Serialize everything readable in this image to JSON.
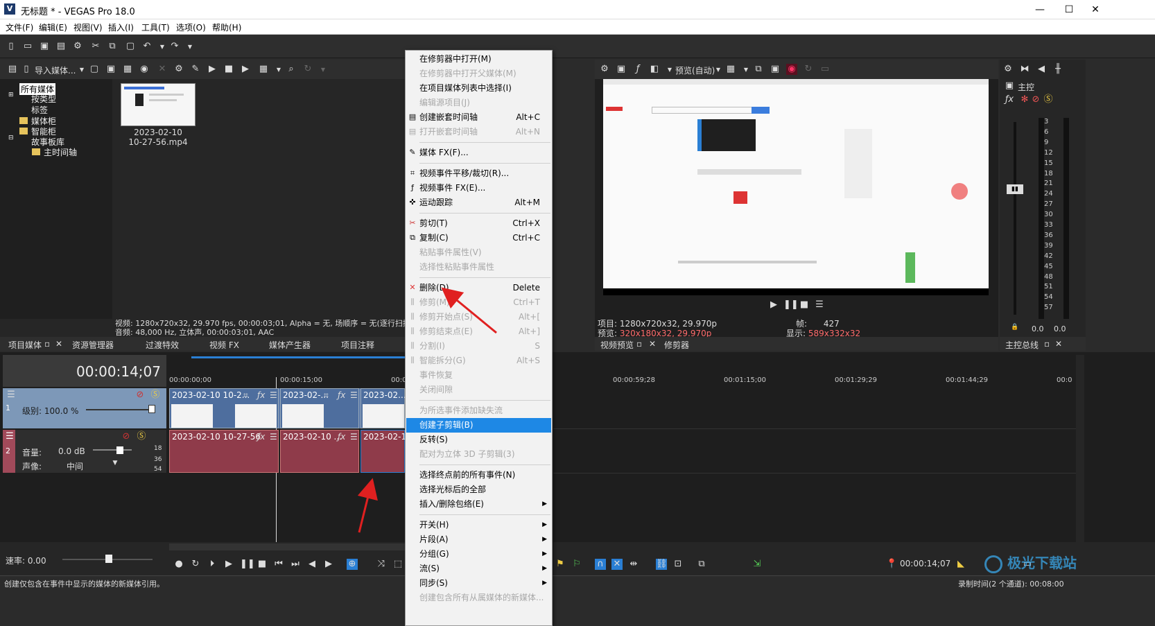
{
  "window": {
    "title": "无标题 * - VEGAS Pro 18.0",
    "logo": "V",
    "min": "—",
    "max": "☐",
    "close": "✕"
  },
  "menu": [
    "文件(F)",
    "编辑(E)",
    "视图(V)",
    "插入(I)",
    "工具(T)",
    "选项(O)",
    "帮助(H)"
  ],
  "media_toolbar": {
    "import_label": "导入媒体..."
  },
  "tree": {
    "items": [
      "所有媒体",
      "按类型",
      "标签",
      "媒体柜",
      "智能柜",
      "故事板库",
      "主时间轴"
    ]
  },
  "media": {
    "name_line1": "2023-02-10",
    "name_line2": "10-27-56.mp4"
  },
  "info": {
    "video_line": "视频: 1280x720x32, 29.970 fps, 00:00:03;01, Alpha = 无, 场顺序 = 无(逐行扫描",
    "audio_line": "音频: 48,000 Hz, 立体声, 00:00:03;01, AAC"
  },
  "left_tabs": [
    "项目媒体",
    "资源管理器",
    "过渡特效",
    "视频 FX",
    "媒体产生器",
    "项目注释"
  ],
  "preview": {
    "mode": "预览(自动)",
    "project_label": "项目:",
    "project_val": "1280x720x32, 29.970p",
    "preview_label": "预览:",
    "preview_val": "320x180x32, 29.970p",
    "frame_label": "帧:",
    "frame_val": "427",
    "display_label": "显示:",
    "display_val": "589x332x32",
    "tabs": [
      "视频预览",
      "修剪器"
    ]
  },
  "master": {
    "label": "主控",
    "tab": "主控总线",
    "scale": [
      "3",
      "6",
      "9",
      "12",
      "15",
      "18",
      "21",
      "24",
      "27",
      "30",
      "33",
      "36",
      "39",
      "42",
      "45",
      "48",
      "51",
      "54",
      "57"
    ],
    "left_val": "0.0",
    "right_val": "0.0"
  },
  "timeline": {
    "timecode": "00:00:14;07",
    "ruler": [
      "00:00:00;00",
      "00:00:15;00",
      "00:0",
      "00:00:59;28",
      "00:01:15;00",
      "00:01:29;29",
      "00:01:44;29",
      "00:0"
    ],
    "track1": {
      "num": "1",
      "level": "级别: 100.0 %"
    },
    "track2": {
      "num": "2",
      "volume_label": "音量:",
      "volume_val": "0.0 dB",
      "pan_label": "声像:",
      "pan_val": "中间",
      "scale": [
        "18",
        "36",
        "54"
      ]
    },
    "video_clips": [
      "2023-02-10 10-2...",
      "2023-02-...",
      "2023-02..."
    ],
    "audio_clips": [
      "2023-02-10 10-27-56",
      "2023-02-10 ...",
      "2023-02-10"
    ],
    "rate": "速率: 0.00",
    "cursor_time": "00:00:14;07",
    "record_time": "录制时间(2 个通道): 00:08:00"
  },
  "status": "创建仅包含在事件中显示的媒体的新媒体引用。",
  "watermark": "极光下载站",
  "context_menu": [
    {
      "label": "在修剪器中打开(M)",
      "enabled": true
    },
    {
      "label": "在修剪器中打开父媒体(M)",
      "enabled": false
    },
    {
      "label": "在项目媒体列表中选择(I)",
      "enabled": true
    },
    {
      "label": "编辑源项目(J)",
      "enabled": false
    },
    {
      "label": "创建嵌套时间轴",
      "shortcut": "Alt+C",
      "enabled": true,
      "icon": "nest-icon"
    },
    {
      "label": "打开嵌套时间轴",
      "shortcut": "Alt+N",
      "enabled": false,
      "icon": "nest-open-icon"
    },
    {
      "sep": true
    },
    {
      "label": "媒体 FX(F)...",
      "enabled": true,
      "icon": "media-fx-icon"
    },
    {
      "sep": true
    },
    {
      "label": "视频事件平移/裁切(R)...",
      "enabled": true,
      "icon": "crop-icon"
    },
    {
      "label": "视频事件 FX(E)...",
      "enabled": true,
      "icon": "fx-icon"
    },
    {
      "label": "运动跟踪",
      "shortcut": "Alt+M",
      "enabled": true,
      "icon": "motion-icon"
    },
    {
      "sep": true
    },
    {
      "label": "剪切(T)",
      "shortcut": "Ctrl+X",
      "enabled": true,
      "icon": "cut-icon"
    },
    {
      "label": "复制(C)",
      "shortcut": "Ctrl+C",
      "enabled": true,
      "icon": "copy-icon"
    },
    {
      "label": "粘贴事件属性(V)",
      "enabled": false
    },
    {
      "label": "选择性粘贴事件属性",
      "enabled": false
    },
    {
      "sep": true
    },
    {
      "label": "删除(D)",
      "shortcut": "Delete",
      "enabled": true,
      "icon": "delete-icon"
    },
    {
      "label": "修剪(M)",
      "shortcut": "Ctrl+T",
      "enabled": false,
      "icon": "trim-icon"
    },
    {
      "label": "修剪开始点(S)",
      "shortcut": "Alt+[",
      "enabled": false,
      "icon": "trim-start-icon"
    },
    {
      "label": "修剪结束点(E)",
      "shortcut": "Alt+]",
      "enabled": false,
      "icon": "trim-end-icon"
    },
    {
      "label": "分割(I)",
      "shortcut": "S",
      "enabled": false,
      "icon": "split-icon"
    },
    {
      "label": "智能拆分(G)",
      "shortcut": "Alt+S",
      "enabled": false,
      "icon": "smart-split-icon"
    },
    {
      "label": "事件恢复",
      "enabled": false
    },
    {
      "label": "关闭间隙",
      "enabled": false
    },
    {
      "sep": true
    },
    {
      "label": "为所选事件添加缺失流",
      "enabled": false
    },
    {
      "label": "创建子剪辑(B)",
      "enabled": true,
      "selected": true
    },
    {
      "label": "反转(S)",
      "enabled": true
    },
    {
      "label": "配对为立体 3D 子剪辑(3)",
      "enabled": false
    },
    {
      "sep": true
    },
    {
      "label": "选择终点前的所有事件(N)",
      "enabled": true
    },
    {
      "label": "选择光标后的全部",
      "enabled": true
    },
    {
      "label": "插入/删除包络(E)",
      "enabled": true,
      "submenu": true
    },
    {
      "sep": true
    },
    {
      "label": "开关(H)",
      "enabled": true,
      "submenu": true
    },
    {
      "label": "片段(A)",
      "enabled": true,
      "submenu": true
    },
    {
      "label": "分组(G)",
      "enabled": true,
      "submenu": true
    },
    {
      "label": "流(S)",
      "enabled": true,
      "submenu": true
    },
    {
      "label": "同步(S)",
      "enabled": true,
      "submenu": true
    },
    {
      "label": "创建包含所有从属媒体的新媒体...",
      "enabled": false
    }
  ],
  "colors": {
    "selection": "#1e88e5",
    "track_video": "#7d98b8",
    "track_audio": "#a14a5a",
    "annotation_arrow": "#e02020",
    "preview_info_red": "#ff6b6b"
  }
}
